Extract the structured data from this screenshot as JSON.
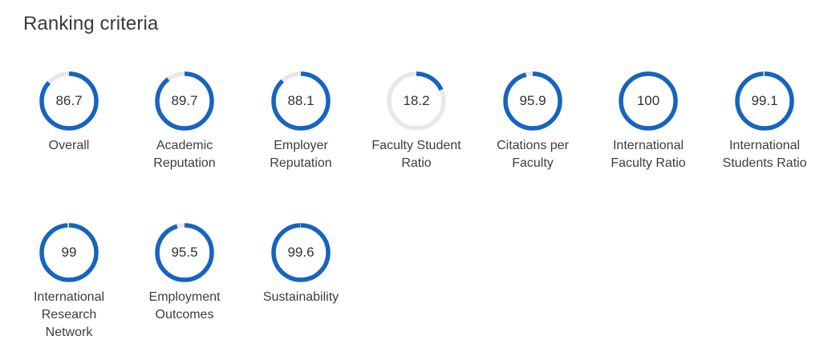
{
  "section": {
    "title": "Ranking criteria"
  },
  "colors": {
    "accent": "#1565c0",
    "track": "#e8e8e8",
    "text": "#333333"
  },
  "criteria": [
    {
      "label": "Overall",
      "value": "86.7",
      "score": 86.7
    },
    {
      "label": "Academic Reputation",
      "value": "89.7",
      "score": 89.7
    },
    {
      "label": "Employer Reputation",
      "value": "88.1",
      "score": 88.1
    },
    {
      "label": "Faculty Student Ratio",
      "value": "18.2",
      "score": 18.2
    },
    {
      "label": "Citations per Faculty",
      "value": "95.9",
      "score": 95.9
    },
    {
      "label": "International Faculty Ratio",
      "value": "100",
      "score": 100
    },
    {
      "label": "International Students Ratio",
      "value": "99.1",
      "score": 99.1
    },
    {
      "label": "International Research Network",
      "value": "99",
      "score": 99
    },
    {
      "label": "Employment Outcomes",
      "value": "95.5",
      "score": 95.5
    },
    {
      "label": "Sustainability",
      "value": "99.6",
      "score": 99.6
    }
  ]
}
